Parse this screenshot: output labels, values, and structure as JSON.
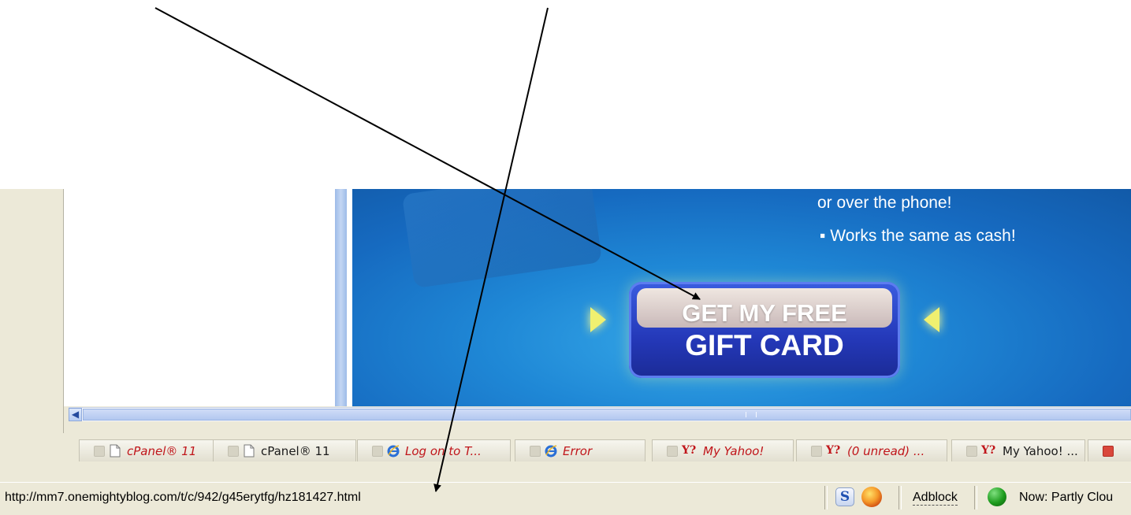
{
  "ad": {
    "line1": "or over the phone!",
    "line2": "▪ Works the same as cash!",
    "cta_line1": "GET MY FREE",
    "cta_line2": "GIFT CARD"
  },
  "tabs": [
    {
      "label": "cPanel® 11",
      "icon": "document-icon",
      "style": "italic-red"
    },
    {
      "label": "cPanel® 11",
      "icon": "document-icon",
      "style": "plain"
    },
    {
      "label": "Log on to T...",
      "icon": "ie-icon",
      "style": "italic-red"
    },
    {
      "label": "Error",
      "icon": "ie-icon",
      "style": "italic-red"
    },
    {
      "label": "My Yahoo!",
      "icon": "yahoo-icon",
      "style": "italic-red"
    },
    {
      "label": "(0 unread) ...",
      "icon": "yahoo-icon",
      "style": "italic-red"
    },
    {
      "label": "My Yahoo! ...",
      "icon": "yahoo-icon",
      "style": "plain"
    }
  ],
  "statusbar": {
    "url": "http://mm7.onemightyblog.com/t/c/942/g45erytfg/hz181427.html",
    "adblock": "Adblock",
    "weather": "Now: Partly Clou"
  }
}
